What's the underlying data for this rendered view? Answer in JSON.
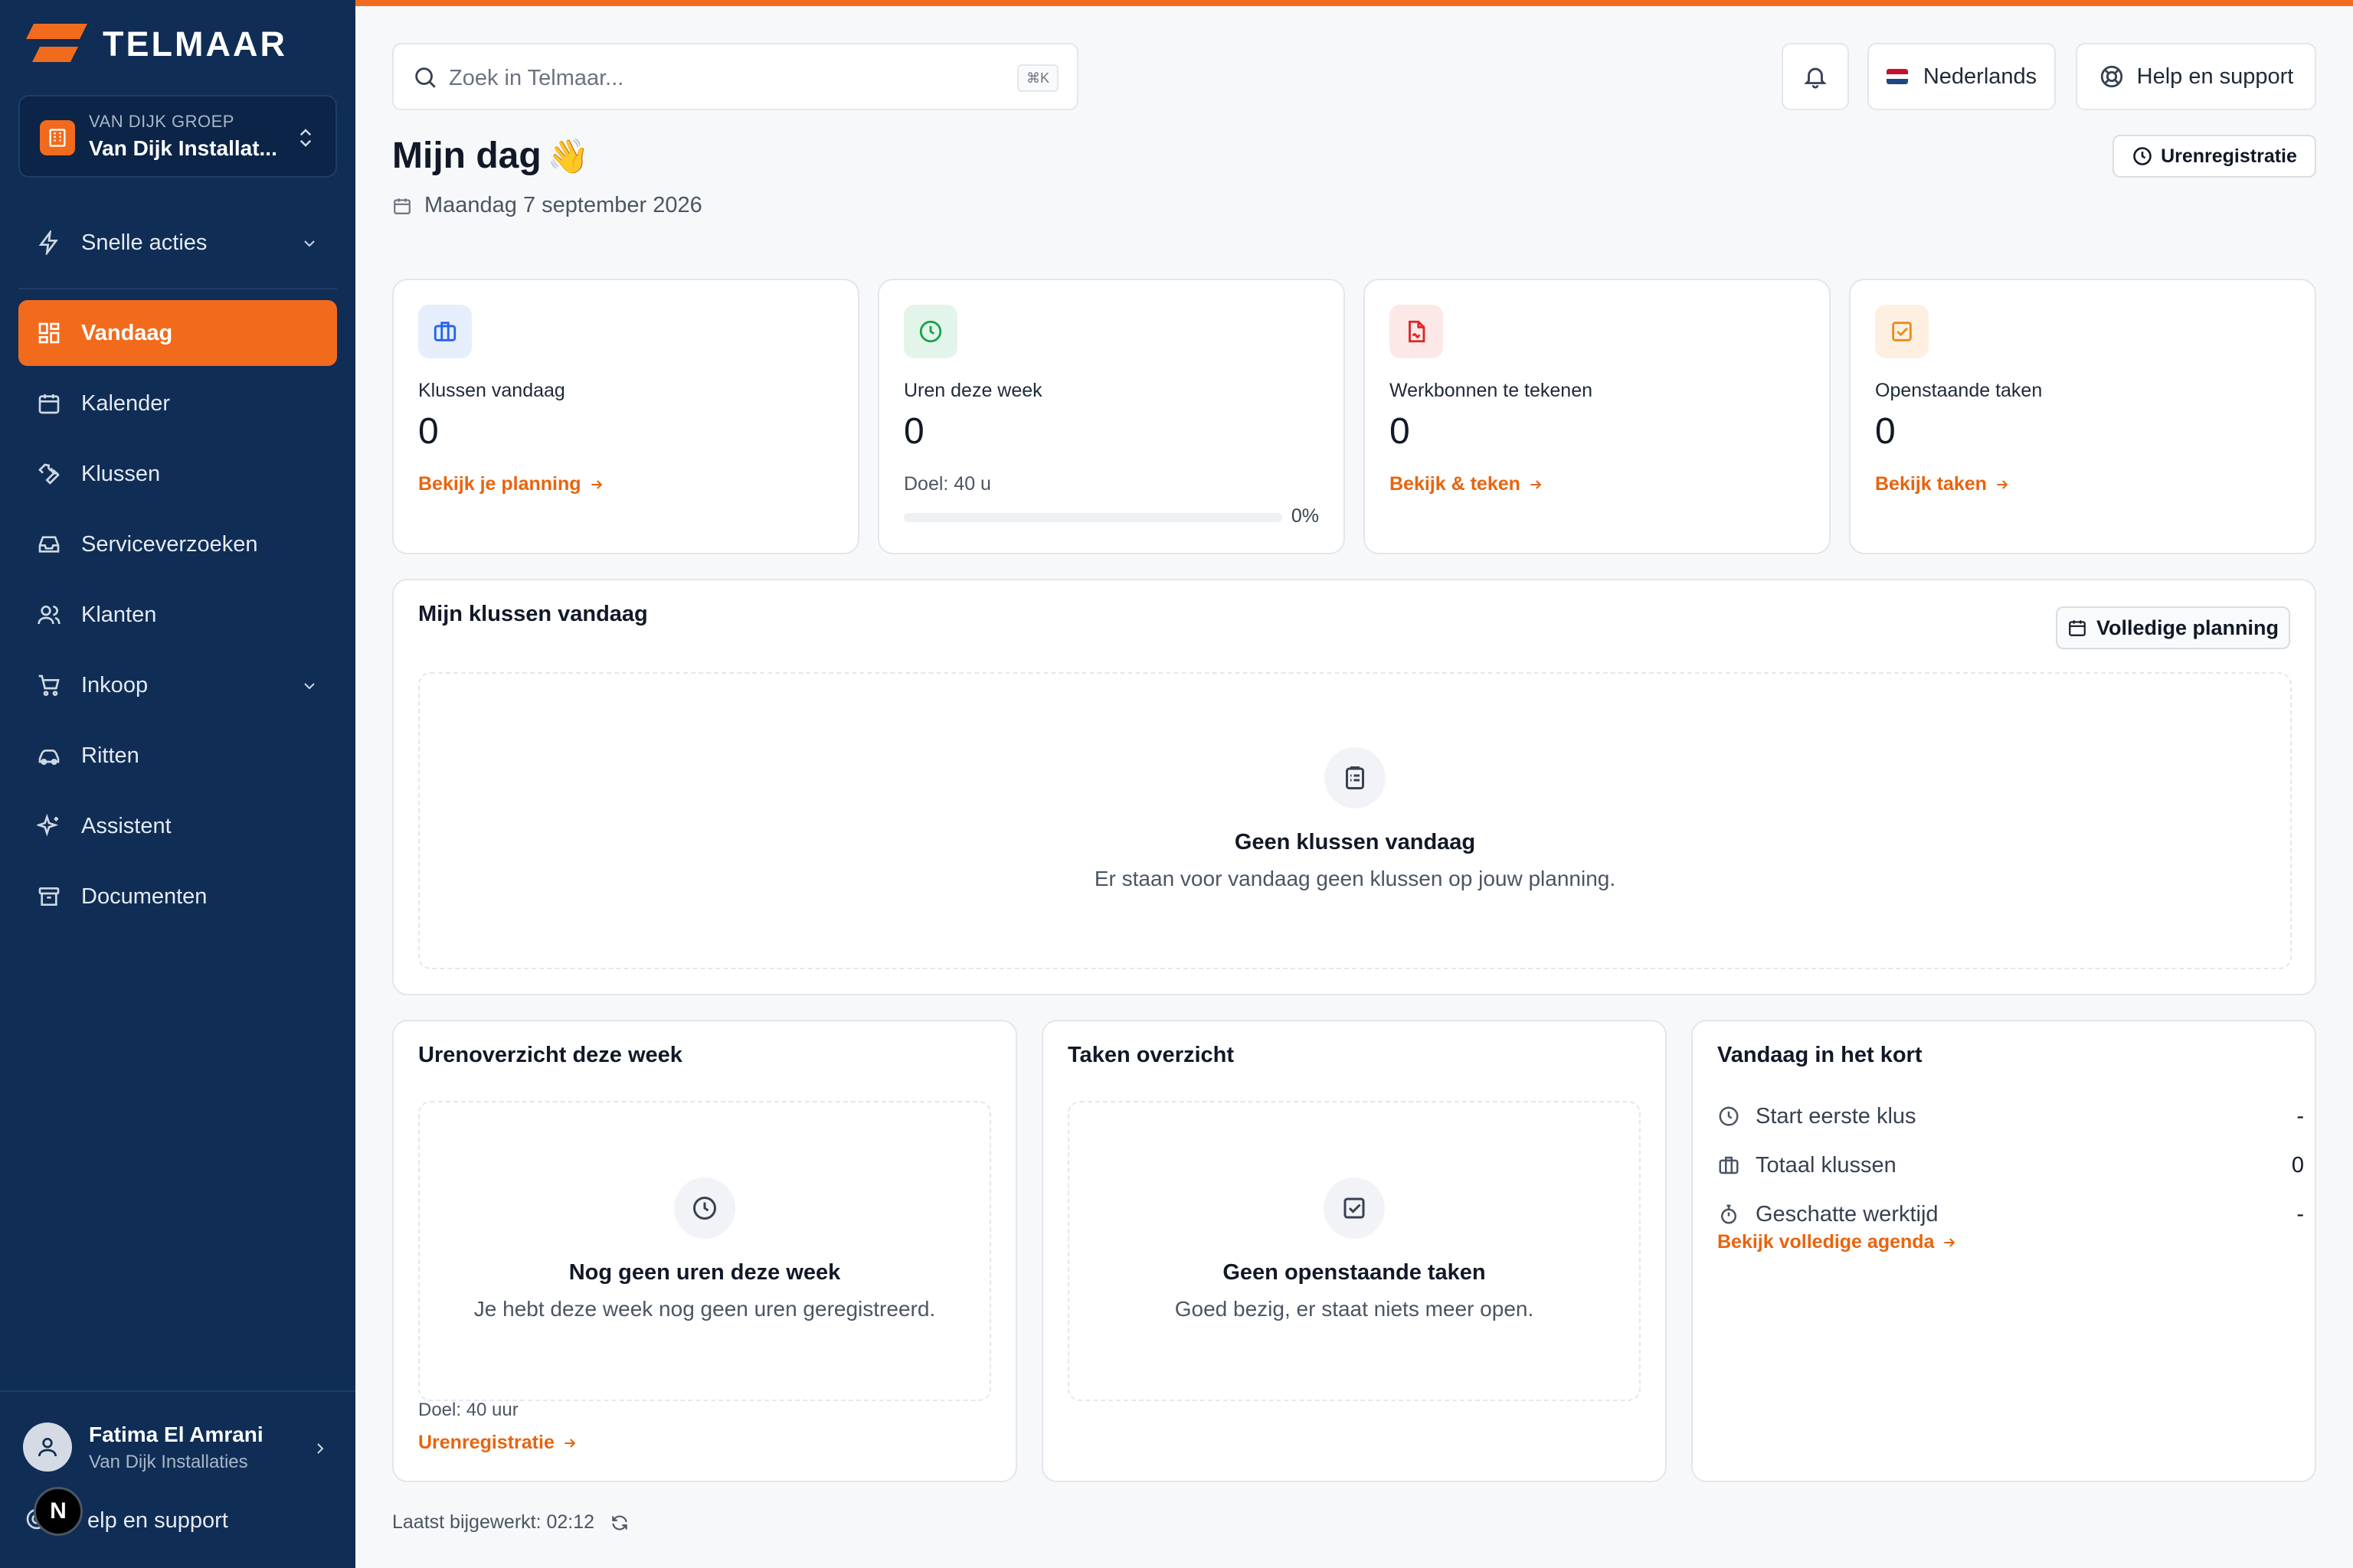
{
  "app": {
    "name": "TELMAAR"
  },
  "colors": {
    "accent": "#f26b1d",
    "sidebar": "#0f2d55",
    "link": "#e8640f"
  },
  "org": {
    "kicker": "VAN DIJK GROEP",
    "name": "Van Dijk Installat..."
  },
  "nav": [
    {
      "label": "Snelle acties",
      "icon": "lightning-icon",
      "expandable": true
    },
    {
      "label": "Vandaag",
      "icon": "dashboard-grid-icon",
      "active": true
    },
    {
      "label": "Kalender",
      "icon": "calendar-icon"
    },
    {
      "label": "Klussen",
      "icon": "wrench-icon"
    },
    {
      "label": "Serviceverzoeken",
      "icon": "inbox-icon"
    },
    {
      "label": "Klanten",
      "icon": "users-icon"
    },
    {
      "label": "Inkoop",
      "icon": "cart-icon",
      "expandable": true
    },
    {
      "label": "Ritten",
      "icon": "car-icon"
    },
    {
      "label": "Assistent",
      "icon": "sparkles-icon"
    },
    {
      "label": "Documenten",
      "icon": "archive-icon"
    }
  ],
  "user": {
    "name": "Fatima El Amrani",
    "org": "Van Dijk Installaties"
  },
  "sidebar_help": "elp en support",
  "dev_badge": "N",
  "search": {
    "placeholder": "Zoek in Telmaar...",
    "shortcut": "⌘K"
  },
  "topbar": {
    "language": "Nederlands",
    "help": "Help en support"
  },
  "page": {
    "title": "Mijn dag",
    "emoji": "👋",
    "date": "Maandag 7 september 2026",
    "time_button": "Urenregistratie"
  },
  "stats": [
    {
      "label": "Klussen vandaag",
      "value": "0",
      "link": "Bekijk je planning",
      "icon": "briefcase-icon"
    },
    {
      "label": "Uren deze week",
      "value": "0",
      "goal": "Doel: 40 u",
      "progress": 0,
      "progress_label": "0%",
      "icon": "clock-icon"
    },
    {
      "label": "Werkbonnen te tekenen",
      "value": "0",
      "link": "Bekijk & teken",
      "icon": "file-sign-icon"
    },
    {
      "label": "Openstaande taken",
      "value": "0",
      "link": "Bekijk taken",
      "icon": "check-square-icon"
    }
  ],
  "jobs": {
    "title": "Mijn klussen vandaag",
    "button": "Volledige planning",
    "empty_title": "Geen klussen vandaag",
    "empty_sub": "Er staan voor vandaag geen klussen op jouw planning."
  },
  "hours": {
    "title": "Urenoverzicht deze week",
    "empty_title": "Nog geen uren deze week",
    "empty_sub": "Je hebt deze week nog geen uren geregistreerd.",
    "goal": "Doel: 40 uur",
    "link": "Urenregistratie"
  },
  "tasks": {
    "title": "Taken overzicht",
    "empty_title": "Geen openstaande taken",
    "empty_sub": "Goed bezig, er staat niets meer open."
  },
  "summary": {
    "title": "Vandaag in het kort",
    "rows": [
      {
        "label": "Start eerste klus",
        "value": "-"
      },
      {
        "label": "Totaal klussen",
        "value": "0"
      },
      {
        "label": "Geschatte werktijd",
        "value": "-"
      }
    ],
    "link": "Bekijk volledige agenda"
  },
  "footer": {
    "updated": "Laatst bijgewerkt: 02:12"
  }
}
